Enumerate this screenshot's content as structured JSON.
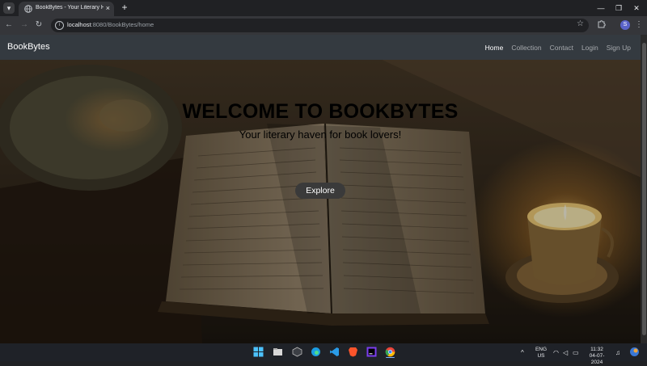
{
  "browser": {
    "tab_title": "BookBytes - Your Literary Haven",
    "tab_close": "×",
    "new_tab": "+",
    "url_host": "localhost",
    "url_path": ":8080/BookBytes/home",
    "profile_initial": "S",
    "window_controls": [
      "minimize-icon",
      "restore-icon",
      "close-icon"
    ]
  },
  "site_nav": {
    "brand": "BookBytes",
    "links": [
      "Home",
      "Collection",
      "Contact",
      "Login",
      "Sign Up"
    ],
    "active": "Home"
  },
  "hero": {
    "title": "WELCOME TO BOOKBYTES",
    "subtitle": "Your literary haven for book lovers!",
    "cta": "Explore"
  },
  "taskbar": {
    "apps": [
      "windows-start-icon",
      "file-explorer-icon",
      "github-icon",
      "edge-icon",
      "vscode-icon",
      "brave-icon",
      "intellij-icon",
      "chrome-icon"
    ],
    "language_top": "ENG",
    "language_bottom": "US",
    "time": "11:32",
    "date": "04-07-2024"
  },
  "colors": {
    "navbar": "#343a40",
    "button": "#3a3a3a",
    "browser_frame": "#202124"
  }
}
